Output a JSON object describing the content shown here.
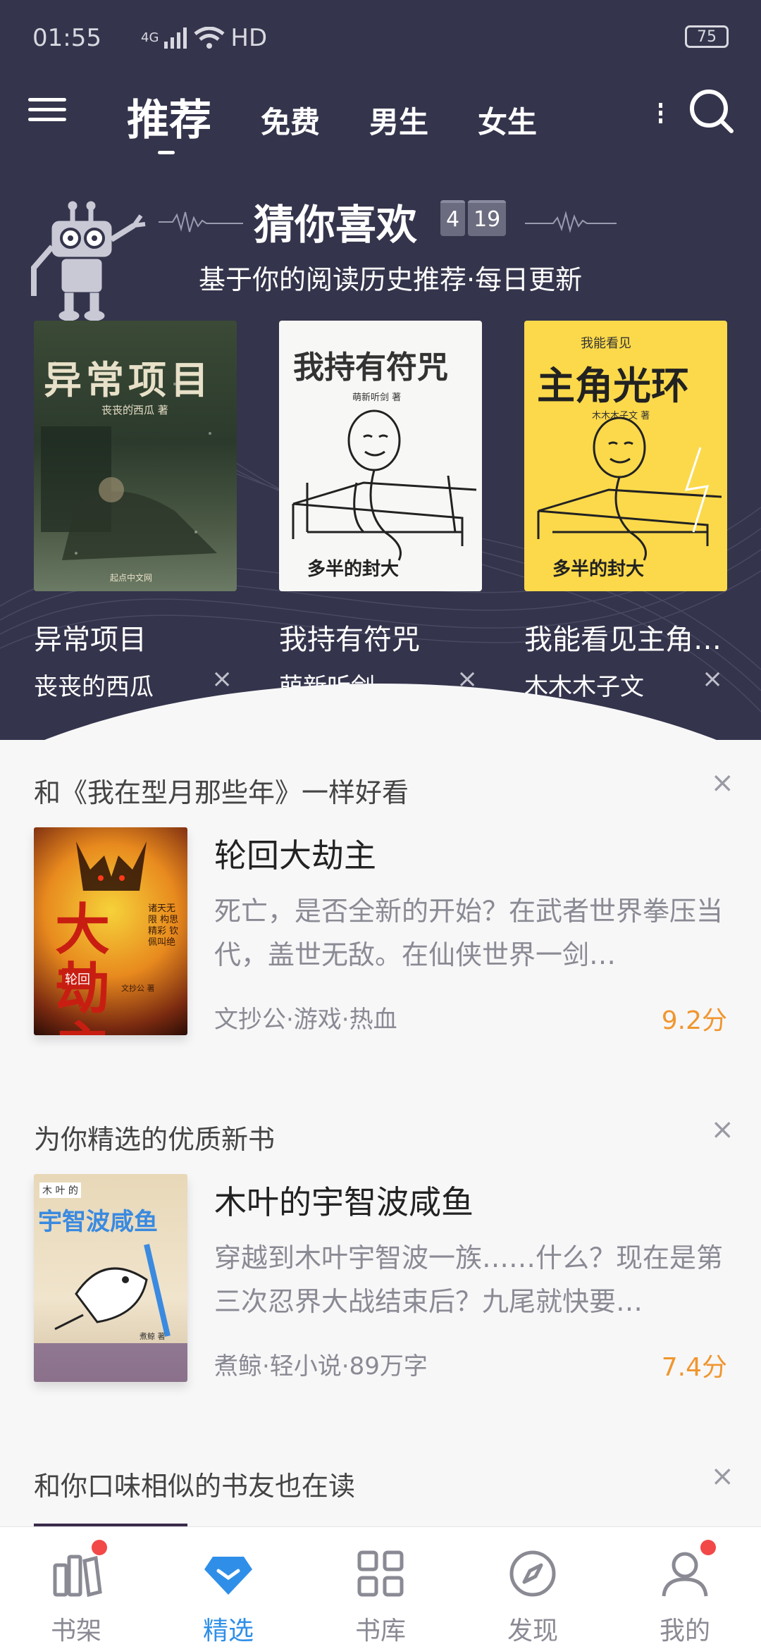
{
  "status": {
    "time": "01:55",
    "net": "4G",
    "hd": "HD",
    "battery": "75"
  },
  "nav": {
    "tabs": [
      "推荐",
      "免费",
      "男生",
      "女生"
    ],
    "active": 0
  },
  "recommend": {
    "title": "猜你喜欢",
    "date_month": "4",
    "date_day": "19",
    "subtitle": "基于你的阅读历史推荐·每日更新",
    "books": [
      {
        "name": "异常项目",
        "author": "丧丧的西瓜",
        "cover_title": "异常项目",
        "cover_author": "丧丧的西瓜 著",
        "cover_badge": "起点中文网"
      },
      {
        "name": "我持有符咒",
        "author": "萌新听剑",
        "cover_title": "我持有符咒",
        "cover_author": "萌新听剑 著",
        "cover_badge": "多半的封大"
      },
      {
        "name": "我能看见主角光环",
        "author": "木木木子文",
        "cover_top": "我能看见",
        "cover_title": "主角光环",
        "cover_author": "木木木子文 著",
        "cover_badge": "多半的封大"
      }
    ],
    "close_glyph": "×"
  },
  "feed": [
    {
      "section_title": "和《我在型月那些年》一样好看",
      "title": "轮回大劫主",
      "desc": "死亡，是否全新的开始？在武者世界拳压当代，盖世无敌。在仙侠世界一剑…",
      "meta": "文抄公·游戏·热血",
      "score": "9.2分",
      "cover_title": "大劫主",
      "cover_small": "轮回",
      "cover_author": "文抄公 著",
      "cover_side": "诸天无限 构思精彩 钦佩叫绝"
    },
    {
      "section_title": "为你精选的优质新书",
      "title": "木叶的宇智波咸鱼",
      "desc": "穿越到木叶宇智波一族……什么？现在是第三次忍界大战结束后？九尾就快要…",
      "meta": "煮鲸·轻小说·89万字",
      "score": "7.4分",
      "cover_top": "木 叶 的",
      "cover_title": "宇智波咸鱼",
      "cover_author": "煮鲸 著"
    },
    {
      "section_title": "和你口味相似的书友也在读"
    }
  ],
  "tabbar": {
    "items": [
      "书架",
      "精选",
      "书库",
      "发现",
      "我的"
    ],
    "active": 1,
    "active_color": "#2f8fe8",
    "accent_score": "#f0962e"
  }
}
